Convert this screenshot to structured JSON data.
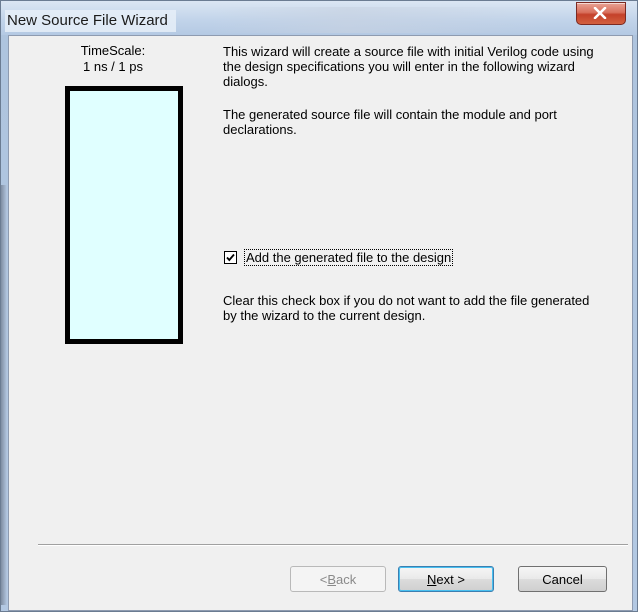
{
  "window": {
    "title": "New Source File Wizard",
    "close_symbol": "✕",
    "accent_color": "#c9453a"
  },
  "timescale": {
    "label": "TimeScale:",
    "value": "1 ns / 1 ps",
    "preview_fill_color": "#e0ffff"
  },
  "description": {
    "paragraph1": "This wizard will create a source file with initial Verilog code using the design specifications you will enter in the following wizard dialogs.",
    "paragraph2": "The generated source file will contain the module and port declarations.",
    "checkbox": {
      "label": "Add the generated file to the design",
      "checked": true
    },
    "paragraph3": "Clear this check box if you do not want to add the file generated by the wizard to the current design."
  },
  "buttons": {
    "back": {
      "prefix": "< ",
      "mnemonic": "B",
      "rest": "ack",
      "enabled": false
    },
    "next": {
      "mnemonic": "N",
      "rest": "ext >",
      "enabled": true
    },
    "cancel": {
      "label": "Cancel",
      "enabled": true
    }
  }
}
